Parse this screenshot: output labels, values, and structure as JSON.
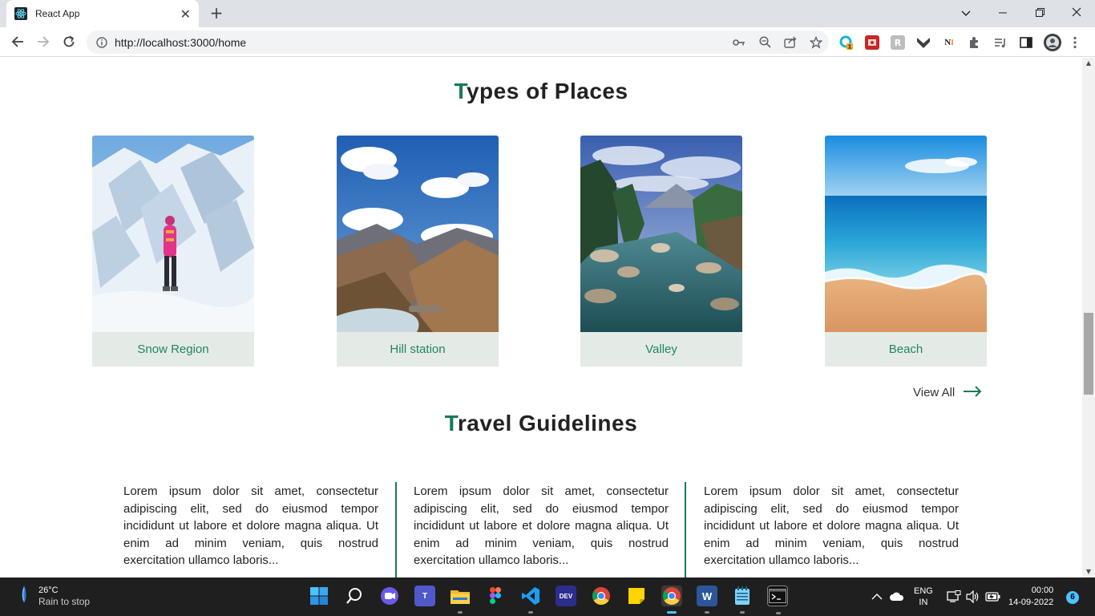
{
  "browser": {
    "tab_title": "React App",
    "url": "http://localhost:3000/home"
  },
  "page": {
    "places_title_first": "T",
    "places_title_rest": "ypes of Places",
    "places": [
      {
        "label": "Snow Region"
      },
      {
        "label": "Hill station"
      },
      {
        "label": "Valley"
      },
      {
        "label": "Beach"
      }
    ],
    "view_all_label": "View All",
    "guidelines_title_first": "T",
    "guidelines_title_rest": "ravel Guidelines",
    "guidelines": [
      {
        "text": "Lorem ipsum dolor sit amet, consectetur adipiscing elit, sed do eiusmod tempor incididunt ut labore et dolore magna aliqua. Ut enim ad minim veniam, quis nostrud exercitation ullamco laboris..."
      },
      {
        "text": "Lorem ipsum dolor sit amet, consectetur adipiscing elit, sed do eiusmod tempor incididunt ut labore et dolore magna aliqua. Ut enim ad minim veniam, quis nostrud exercitation ullamco laboris..."
      },
      {
        "text": "Lorem ipsum dolor sit amet, consectetur adipiscing elit, sed do eiusmod tempor incididunt ut labore et dolore magna aliqua. Ut enim ad minim veniam, quis nostrud exercitation ullamco laboris..."
      }
    ],
    "accent_color": "#177a5c"
  },
  "taskbar": {
    "weather_temp": "26°C",
    "weather_desc": "Rain to stop",
    "lang_line1": "ENG",
    "lang_line2": "IN",
    "time": "00:00",
    "date": "14-09-2022",
    "notification_count": "6"
  }
}
